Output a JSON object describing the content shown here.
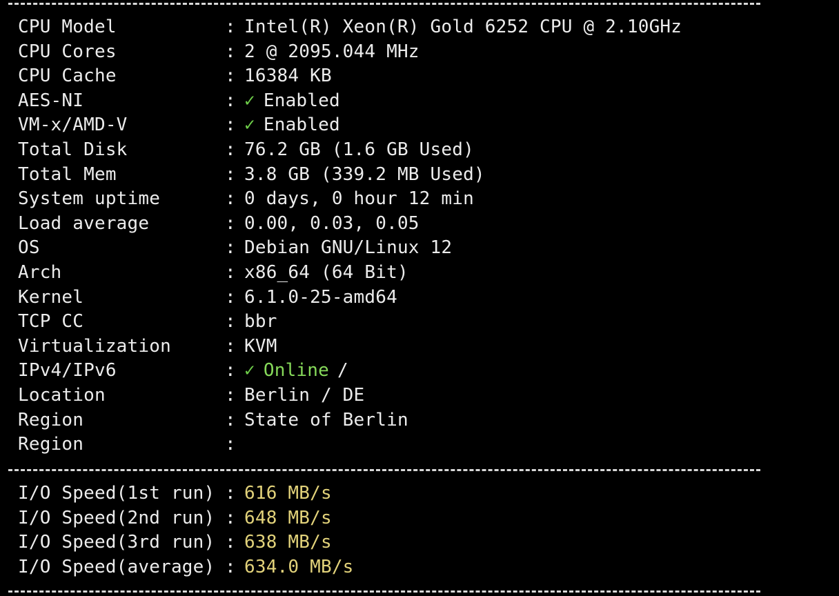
{
  "colors": {
    "background": "#000000",
    "text": "#ececec",
    "green": "#86d95a",
    "check": "#6fcf4a",
    "yellow": "#e2d27a"
  },
  "info": {
    "cpu_model": {
      "label": "CPU Model",
      "value": "Intel(R) Xeon(R) Gold 6252 CPU @ 2.10GHz"
    },
    "cpu_cores": {
      "label": "CPU Cores",
      "value": "2 @ 2095.044 MHz"
    },
    "cpu_cache": {
      "label": "CPU Cache",
      "value": "16384 KB"
    },
    "aes_ni": {
      "label": "AES-NI",
      "check": "✓",
      "value": "Enabled"
    },
    "vmx": {
      "label": "VM-x/AMD-V",
      "check": "✓",
      "value": "Enabled"
    },
    "total_disk": {
      "label": "Total Disk",
      "value": "76.2 GB (1.6 GB Used)"
    },
    "total_mem": {
      "label": "Total Mem",
      "value": "3.8 GB (339.2 MB Used)"
    },
    "uptime": {
      "label": "System uptime",
      "value": "0 days, 0 hour 12 min"
    },
    "load": {
      "label": "Load average",
      "value": "0.00, 0.03, 0.05"
    },
    "os": {
      "label": "OS",
      "value": "Debian GNU/Linux 12"
    },
    "arch": {
      "label": "Arch",
      "value": "x86_64 (64 Bit)"
    },
    "kernel": {
      "label": "Kernel",
      "value": "6.1.0-25-amd64"
    },
    "tcp_cc": {
      "label": "TCP CC",
      "value": "bbr"
    },
    "virt": {
      "label": "Virtualization",
      "value": "KVM"
    },
    "ip": {
      "label": "IPv4/IPv6",
      "check": "✓",
      "value": "Online",
      "suffix": "/"
    },
    "location": {
      "label": "Location",
      "value": "Berlin / DE"
    },
    "region": {
      "label": "Region",
      "value": "State of Berlin"
    },
    "region2": {
      "label": "Region",
      "value": ""
    }
  },
  "io": {
    "run1": {
      "label": "I/O Speed(1st run)",
      "value": "616 MB/s"
    },
    "run2": {
      "label": "I/O Speed(2nd run)",
      "value": "648 MB/s"
    },
    "run3": {
      "label": "I/O Speed(3rd run)",
      "value": "638 MB/s"
    },
    "average": {
      "label": "I/O Speed(average)",
      "value": "634.0 MB/s"
    }
  },
  "separator": ":"
}
